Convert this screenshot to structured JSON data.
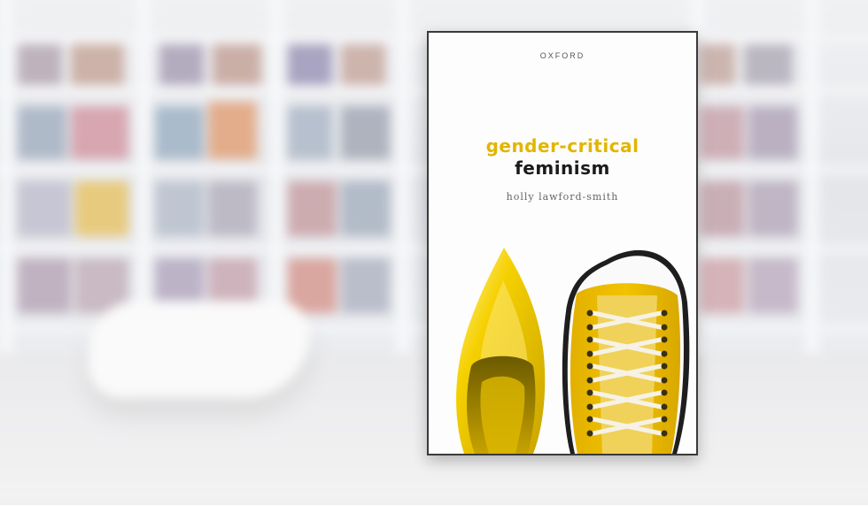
{
  "cover": {
    "publisher": "OXFORD",
    "title_line1": "gender-critical",
    "title_line2": "feminism",
    "author": "holly lawford-smith"
  },
  "colors": {
    "title_accent": "#e2b500",
    "shoe_yellow": "#f2c300",
    "heel_yellow": "#f5d000",
    "background": "#e9eaec"
  },
  "scene": {
    "background_description_icons": [
      "bookshelf-image",
      "chaise-lounge-image",
      "high-heel-shoe-image",
      "sneaker-shoe-image"
    ]
  }
}
